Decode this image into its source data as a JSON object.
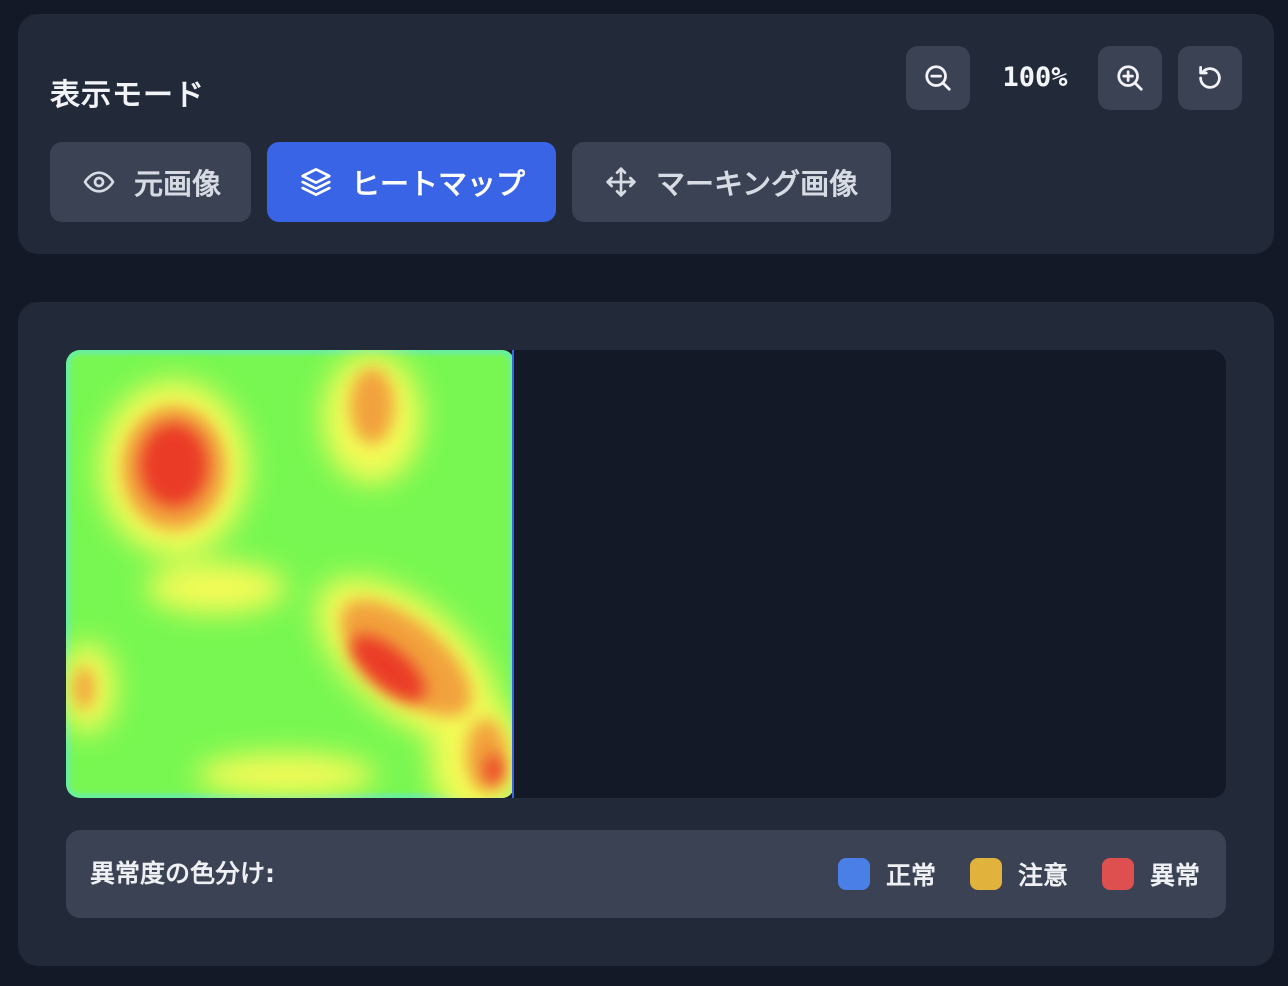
{
  "mode_panel": {
    "title": "表示モード",
    "zoom_value": "100%",
    "modes": [
      {
        "label": "元画像",
        "icon": "eye-icon",
        "active": false
      },
      {
        "label": "ヒートマップ",
        "icon": "layers-icon",
        "active": true
      },
      {
        "label": "マーキング画像",
        "icon": "move-arrows-icon",
        "active": false
      }
    ],
    "controls": [
      "zoom-out-icon",
      "zoom-in-icon",
      "reset-rotate-icon"
    ]
  },
  "viewer": {
    "legend": {
      "title": "異常度の色分け:",
      "items": [
        {
          "label": "正常",
          "color": "#4a7fe8"
        },
        {
          "label": "注意",
          "color": "#e2b33c"
        },
        {
          "label": "異常",
          "color": "#de4f4f"
        }
      ]
    }
  },
  "colors": {
    "background": "#131926",
    "panel": "#222938",
    "button": "#3a4253",
    "accent": "#3a64e6"
  }
}
